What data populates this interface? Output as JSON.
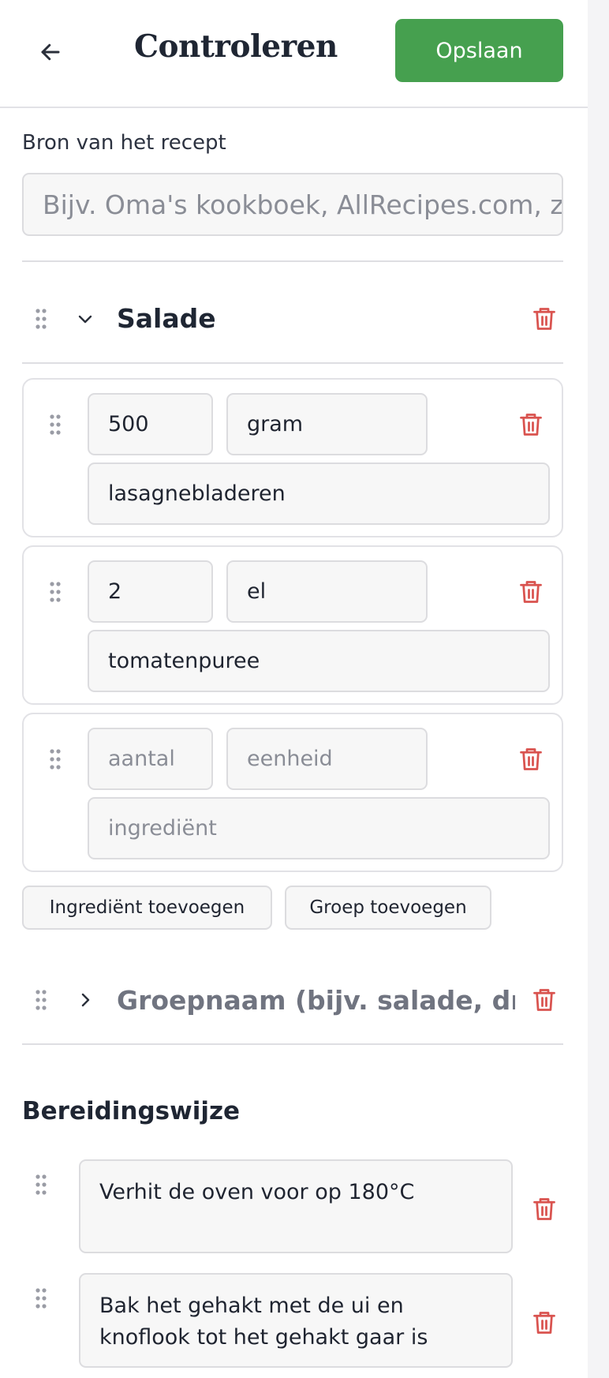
{
  "header": {
    "back_icon": "arrow-left-icon",
    "title": "Controleren",
    "save_label": "Opslaan"
  },
  "source": {
    "label": "Bron van het recept",
    "placeholder": "Bijv. Oma's kookboek, AllRecipes.com, z"
  },
  "groups": [
    {
      "name": "Salade",
      "expanded": true,
      "ingredients": [
        {
          "amount": "500",
          "unit": "gram",
          "name": "lasagnebladeren"
        },
        {
          "amount": "2",
          "unit": "el",
          "name": "tomatenpuree"
        },
        {
          "amount": "",
          "unit": "",
          "name": ""
        }
      ]
    },
    {
      "name": "",
      "expanded": false
    }
  ],
  "ingredient_placeholders": {
    "amount": "aantal",
    "unit": "eenheid",
    "name": "ingrediënt"
  },
  "actions": {
    "add_ingredient": "Ingrediënt toevoegen",
    "add_group": "Groep toevoegen"
  },
  "group_name_placeholder": "Groepnaam (bijv. salade, dress",
  "preparation": {
    "title": "Bereidingswijze",
    "steps": [
      "Verhit de oven voor op 180°C",
      "Bak het gehakt met de ui en knoflook tot het gehakt gaar is"
    ]
  },
  "colors": {
    "accent_green": "#46a04f",
    "delete_red": "#d9534f"
  }
}
